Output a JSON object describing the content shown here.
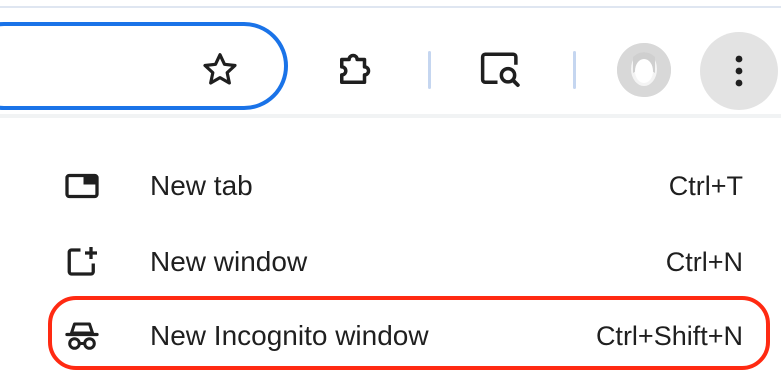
{
  "toolbar": {
    "bookmark_icon": "star-icon",
    "extensions_icon": "puzzle-icon",
    "lens_icon": "search-page-icon",
    "profile_icon": "avatar",
    "menu_icon": "three-dots-vertical-icon",
    "accent_color": "#1a73e8"
  },
  "menu": {
    "items": [
      {
        "label": "New tab",
        "shortcut": "Ctrl+T",
        "icon": "new-tab-icon"
      },
      {
        "label": "New window",
        "shortcut": "Ctrl+N",
        "icon": "new-window-icon"
      },
      {
        "label": "New Incognito window",
        "shortcut": "Ctrl+Shift+N",
        "icon": "incognito-icon"
      }
    ],
    "highlight_color": "#ff2a12"
  }
}
